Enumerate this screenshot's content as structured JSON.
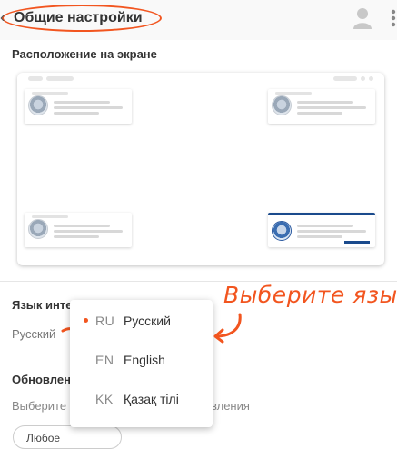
{
  "header": {
    "back_chevron": "‹",
    "title": "Общие настройки",
    "user_icon": "user-icon",
    "more_icon": "more-vertical-icon"
  },
  "position": {
    "title": "Расположение на экране"
  },
  "language": {
    "title": "Язык интерфейса",
    "current": "Русский",
    "options": [
      {
        "code": "RU",
        "label": "Русский",
        "selected": true
      },
      {
        "code": "EN",
        "label": "English",
        "selected": false
      },
      {
        "code": "KK",
        "label": "Қазақ тілі",
        "selected": false
      }
    ]
  },
  "annotation": {
    "text": "Выберите язык"
  },
  "updates": {
    "title": "Обновлен",
    "desc_start": "Выберите",
    "desc_end": "вления",
    "select_value": "Любое"
  },
  "colors": {
    "accent": "#f2551f",
    "brand_blue": "#1a4a8c"
  }
}
